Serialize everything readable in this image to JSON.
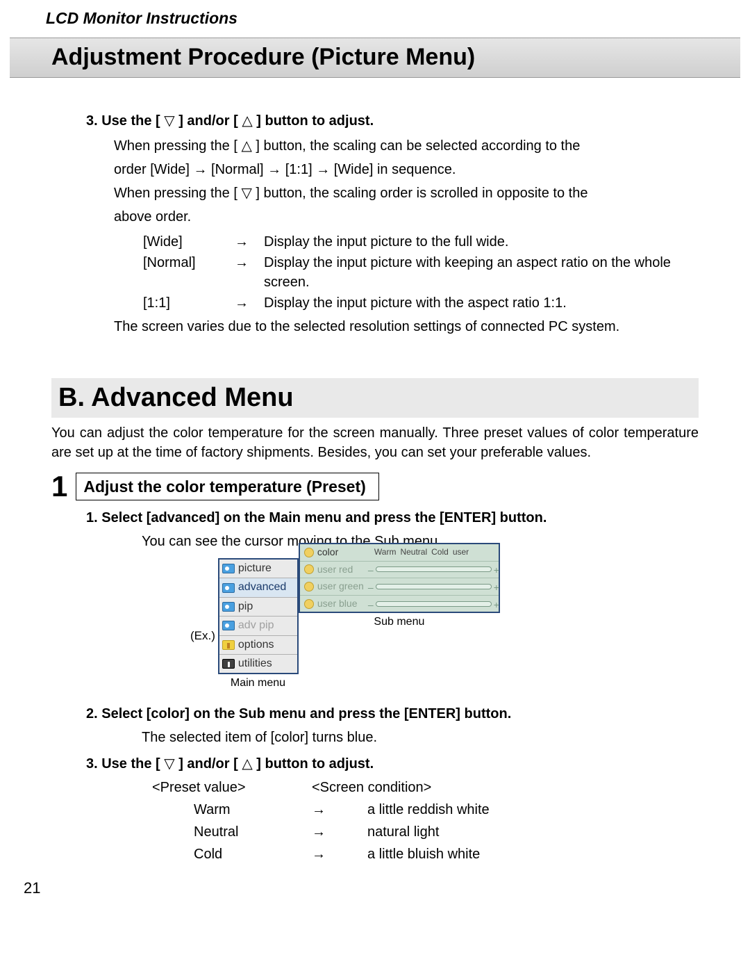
{
  "doc_title": "LCD Monitor Instructions",
  "banner": "Adjustment Procedure (Picture Menu)",
  "step3": {
    "heading_prefix": "3. Use the [ ",
    "heading_mid": " ] and/or [ ",
    "heading_suffix": " ] button to adjust.",
    "line1_a": "When pressing the [ ",
    "line1_b": " ] button, the scaling can be selected according to the",
    "line2": "order [Wide] → [Normal] → [1:1] → [Wide] in sequence.",
    "line3_a": "When pressing the [ ",
    "line3_b": " ] button, the scaling order is scrolled in opposite to the",
    "line4": "above order.",
    "rows": [
      {
        "mode": "[Wide]",
        "arrow": "→",
        "desc": "Display the input picture to the full wide."
      },
      {
        "mode": "[Normal]",
        "arrow": "→",
        "desc": "Display the input picture with keeping an aspect ratio on the whole screen."
      },
      {
        "mode": "[1:1]",
        "arrow": "→",
        "desc": "Display the input picture with the aspect ratio 1:1."
      }
    ],
    "tail": "The screen varies due to the selected resolution settings of connected PC system."
  },
  "sectionB": {
    "banner": "B. Advanced Menu",
    "intro": "You can adjust the color temperature for the screen manually. Three preset values of color temperature are set up at the time of factory shipments. Besides, you can set your preferable values.",
    "number": "1",
    "title": "Adjust the color temperature (Preset)",
    "step1": {
      "heading": "1. Select [advanced] on the Main menu and press the [ENTER] button.",
      "body": "You can see the cursor moving to the Sub menu.",
      "ex": "(Ex.)",
      "main_menu_items": [
        {
          "label": "picture",
          "state": "normal"
        },
        {
          "label": "advanced",
          "state": "selected"
        },
        {
          "label": "pip",
          "state": "normal"
        },
        {
          "label": "adv pip",
          "state": "dim"
        },
        {
          "label": "options",
          "state": "normal"
        },
        {
          "label": "utilities",
          "state": "normal"
        }
      ],
      "main_caption": "Main menu",
      "sub_header_label": "color",
      "sub_header_opts": [
        "Warm",
        "Neutral",
        "Cold",
        "user"
      ],
      "sub_rows": [
        {
          "label": "user  red"
        },
        {
          "label": "user  green"
        },
        {
          "label": "user  blue"
        }
      ],
      "sub_caption": "Sub menu"
    },
    "step2": {
      "heading": "2. Select [color] on the Sub menu and press the [ENTER] button.",
      "body": "The selected item of [color] turns blue."
    },
    "step3": {
      "heading_prefix": "3. Use the [ ",
      "heading_mid": " ] and/or [ ",
      "heading_suffix": " ] button to adjust.",
      "header_preset": "<Preset value>",
      "header_screen": "<Screen condition>",
      "rows": [
        {
          "preset": "Warm",
          "arrow": "→",
          "cond": "a little reddish white"
        },
        {
          "preset": "Neutral",
          "arrow": "→",
          "cond": "natural light"
        },
        {
          "preset": "Cold",
          "arrow": "→",
          "cond": "a little bluish white"
        }
      ]
    }
  },
  "page": "21"
}
